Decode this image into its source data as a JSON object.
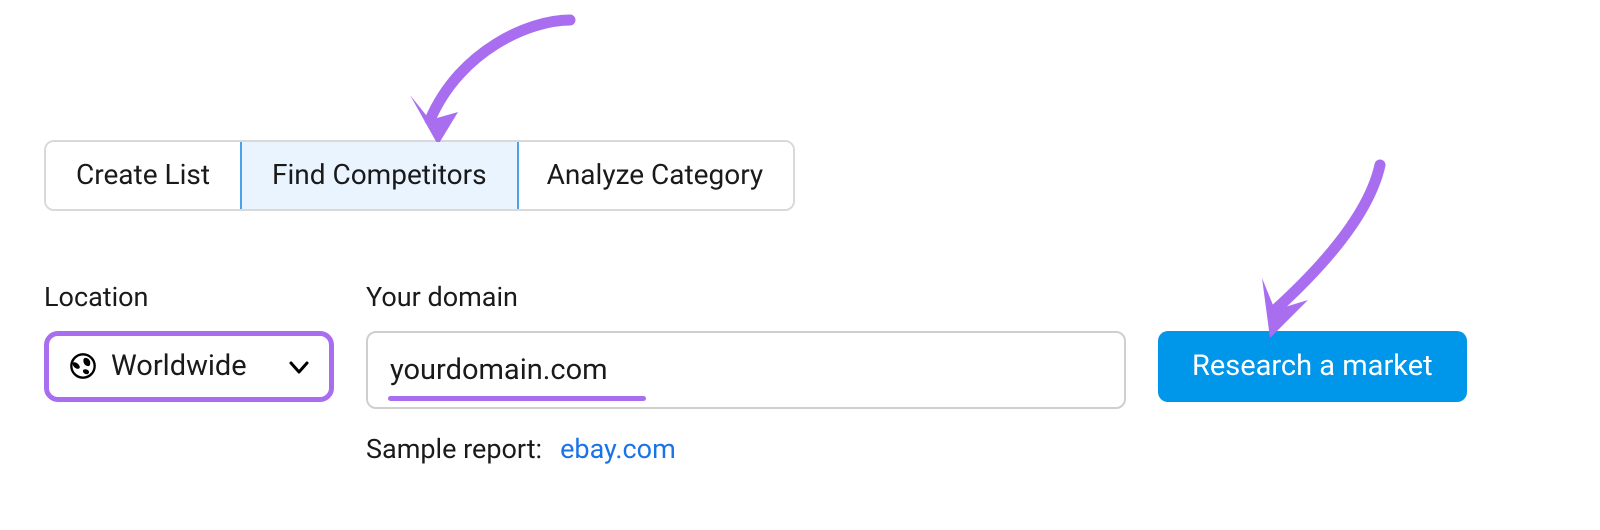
{
  "tabs": {
    "create_list": "Create List",
    "find_competitors": "Find Competitors",
    "analyze_category": "Analyze Category"
  },
  "form": {
    "location_label": "Location",
    "location_value": "Worldwide",
    "domain_label": "Your domain",
    "domain_value": "yourdomain.com",
    "research_button": "Research a market"
  },
  "sample": {
    "label": "Sample report:",
    "link_text": "ebay.com"
  },
  "colors": {
    "annotation": "#a96ef0",
    "primary_button": "#0096ea",
    "active_tab_bg": "#e9f4fe",
    "active_tab_border": "#4aa3e8",
    "link": "#1a73e8"
  }
}
